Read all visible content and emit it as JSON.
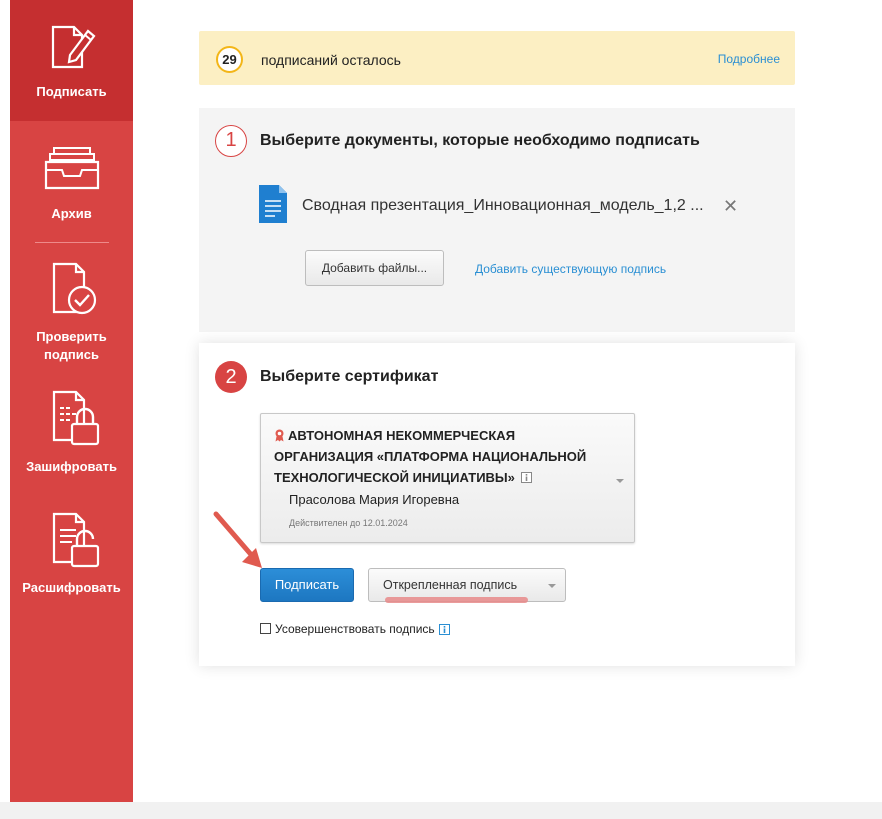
{
  "sidebar": {
    "items": [
      {
        "label": "Подписать",
        "icon": "sign-document-icon",
        "active": true
      },
      {
        "label": "Архив",
        "icon": "archive-tray-icon"
      },
      {
        "label": "Проверить подпись",
        "icon": "verify-document-icon"
      },
      {
        "label": "Зашифровать",
        "icon": "encrypt-lock-icon"
      },
      {
        "label": "Расшифровать",
        "icon": "decrypt-unlock-icon"
      }
    ]
  },
  "banner": {
    "count": "29",
    "text": "подписаний осталось",
    "link": "Подробнее"
  },
  "step1": {
    "number": "1",
    "title": "Выберите документы, которые необходимо подписать",
    "file_name": "Сводная презентация_Инновационная_модель_1,2 ...",
    "add_files_button": "Добавить файлы...",
    "add_existing_link": "Добавить существующую подпись"
  },
  "step2": {
    "number": "2",
    "title": "Выберите сертификат",
    "certificate": {
      "organization": "АВТОНОМНАЯ НЕКОММЕРЧЕСКАЯ ОРГАНИЗАЦИЯ «ПЛАТФОРМА НАЦИОНАЛЬНОЙ ТЕХНОЛОГИЧЕСКОЙ ИНИЦИАТИВЫ»",
      "owner": "Прасолова Мария Игоревна",
      "valid_until": "Действителен до 12.01.2024"
    },
    "sign_button": "Подписать",
    "signature_type": "Открепленная подпись",
    "enhance_checkbox": "Усовершенствовать подпись"
  },
  "colors": {
    "sidebar": "#d84443",
    "sidebar_active": "#c52f30",
    "banner_bg": "#fcefc3",
    "link": "#2a8fd3",
    "primary_button": "#2384cf",
    "annotation": "#e05a4f"
  }
}
